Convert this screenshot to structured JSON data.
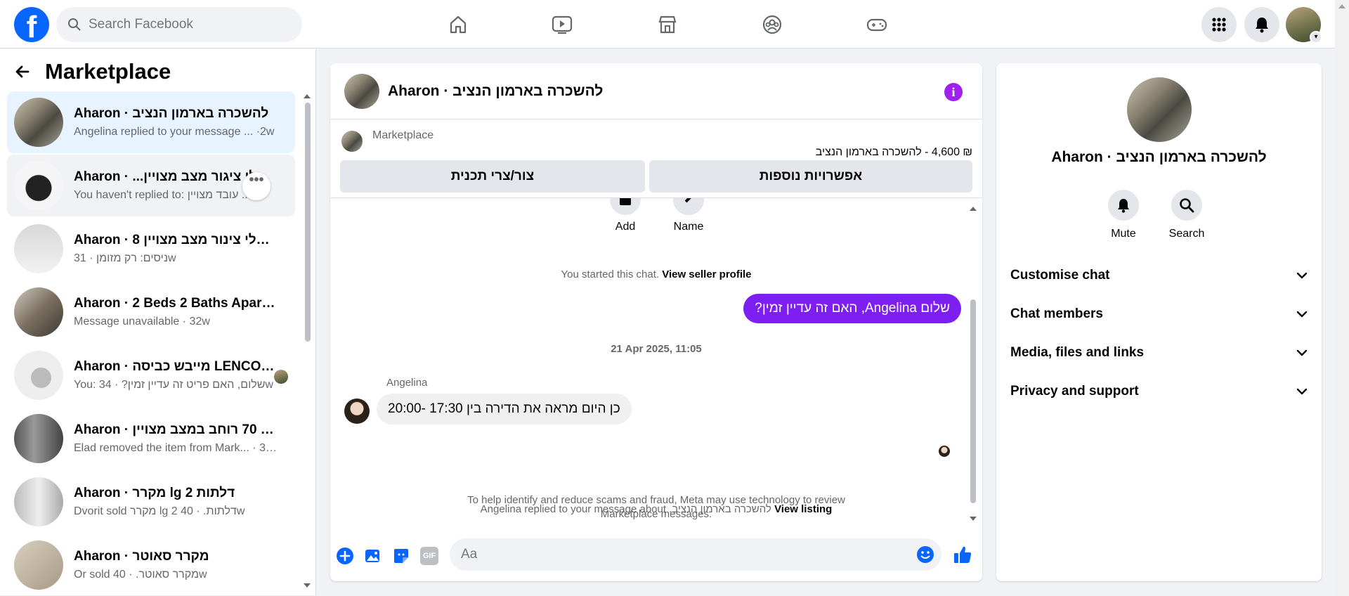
{
  "topbar": {
    "logo_letter": "f",
    "search_placeholder": "Search Facebook",
    "nav_icons": [
      "home-icon",
      "video-icon",
      "marketplace-icon",
      "groups-icon",
      "gaming-icon"
    ],
    "right_icons": [
      "menu-grid-icon",
      "notifications-icon"
    ],
    "accent": "#0866ff"
  },
  "sidebar": {
    "back_icon": "arrow-left-icon",
    "title": "Marketplace",
    "conversations": [
      {
        "title": "Aharon · להשכרה בארמון הנציב",
        "preview": "Angelina replied to your message ... ·2w",
        "selected": true
      },
      {
        "title": "Aharon · ...קילו בלי ציגור מצב מצויין",
        "preview": "You haven't replied to: עובד מצויין ...",
        "hovered": true
      },
      {
        "title": "Aharon · 8 קילו בלי צינור מצב מצויין ...",
        "preview": "ניסים: רק מזומן · 31w"
      },
      {
        "title": "Aharon · 2 Beds 2 Baths Apartm...",
        "preview": "Message unavailable · 32w"
      },
      {
        "title": "Aharon · מייבש כביסה LENCO 7...",
        "preview": "You: שלום, האם פריט זה עדיין זמין? · 34w"
      },
      {
        "title": "Aharon · ליטר 70 רוחב במצב מצויין ...",
        "preview": "Elad removed the item from Mark... · 34w"
      },
      {
        "title": "Aharon · מקרר lg 2 דלתות",
        "preview": "Dvorit sold מקרר lg 2 דלתות. · 40w"
      },
      {
        "title": "Aharon · מקרר סאוטר",
        "preview": "Or sold מקרר סאוטר. · 40w"
      }
    ]
  },
  "chat": {
    "header_name": "Aharon · להשכרה בארמון הנציב",
    "marketplace_label": "Marketplace",
    "listing_line": "₪ 4,600 - להשכרה בארמון הנציב",
    "btn_more_options": "אפשרויות נוספות",
    "btn_contact": "צור/צרי תכנית",
    "quick_actions": [
      {
        "label": "Add"
      },
      {
        "label": "Name"
      }
    ],
    "started_text": "You started this chat.",
    "view_seller_profile": "View seller profile",
    "my_message": "שלום Angelina, האם זה עדיין זמין?",
    "timestamp": "21 Apr 2025, 11:05",
    "sender_name": "Angelina",
    "their_message": "כן היום מראה את הדירה בין 17:30 -20:00",
    "scam_notice_line1": "To help identify and reduce scams and fraud, Meta may use technology to review",
    "scam_notice_line2": "Marketplace messages.",
    "replied_prefix": "Angelina replied to your message about",
    "replied_item": "להשכרה בארמון הנציב.",
    "view_listing": "View listing",
    "composer_placeholder": "Aa",
    "gif_label": "GIF",
    "my_bubble_color": "#7c1ff0"
  },
  "details": {
    "name": "Aharon · להשכרה בארמון הנציב",
    "actions": [
      {
        "label": "Mute",
        "icon": "bell-icon"
      },
      {
        "label": "Search",
        "icon": "search-icon"
      }
    ],
    "sections": [
      "Customise chat",
      "Chat members",
      "Media, files and links",
      "Privacy and support"
    ]
  }
}
